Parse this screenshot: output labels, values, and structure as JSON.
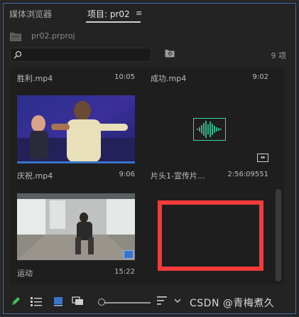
{
  "tabs": {
    "media_browser": "媒体浏览器",
    "project": "项目: pr02",
    "menu_icon": "hamburger-menu-icon"
  },
  "project_file": {
    "name": "pr02.prproj",
    "icon": "folder-icon"
  },
  "search": {
    "value": "",
    "placeholder": "",
    "icon": "search-icon"
  },
  "item_count": "9 项",
  "items": [
    {
      "name": "胜利.mp4",
      "duration": "10:05"
    },
    {
      "name": "成功.mp4",
      "duration": "9:02"
    },
    {
      "name": "庆祝.mp4",
      "duration": "9:06"
    },
    {
      "name": "片头1-宣传片...",
      "duration": "2:56:09551"
    },
    {
      "name": "运动",
      "duration": "15:22"
    }
  ],
  "watermark": "CSDN @青梅煮久",
  "colors": {
    "accent_blue": "#3f6fb0",
    "waveform_green": "#3fd3a3",
    "highlight_red": "#f23b3b",
    "pen_green": "#3fbf5a"
  },
  "toolbar_icons": [
    "pencil-icon",
    "list-view-icon",
    "icon-view-icon",
    "freeform-view-icon",
    "zoom-slider",
    "sort-icon",
    "chevron-down-icon"
  ]
}
